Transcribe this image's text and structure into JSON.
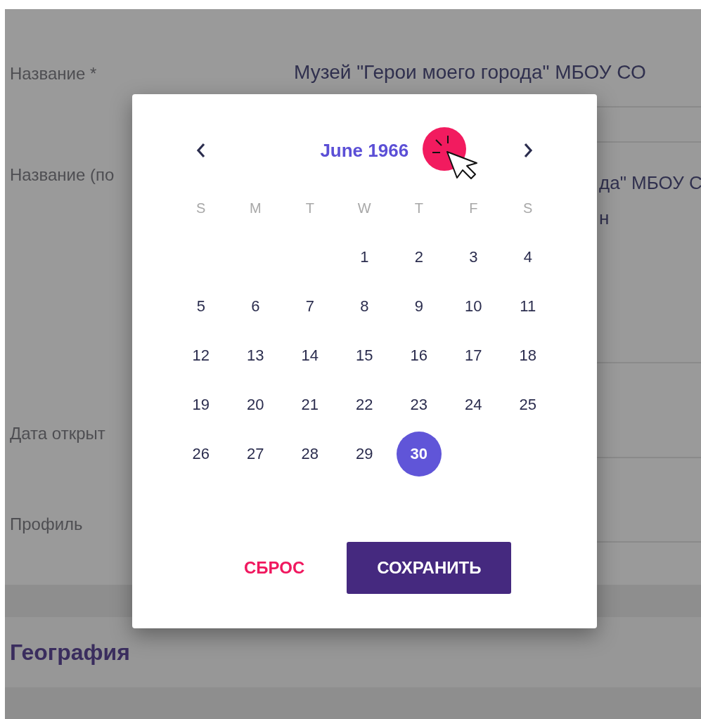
{
  "form": {
    "fields": [
      {
        "label": "Название *",
        "kind": "plain",
        "value_lines": [
          "Музей \"Герои моего города\" МБОУ СО"
        ]
      },
      {
        "label": "Название (по",
        "kind": "partly_covered",
        "value_lines": [
          "да\" МБОУ С",
          "н"
        ]
      },
      {
        "label": "Дата открыт",
        "kind": "plain"
      },
      {
        "label": "Профиль",
        "kind": "plain"
      }
    ]
  },
  "section": {
    "title": "География"
  },
  "date_picker": {
    "month_title": "June 1966",
    "weekdays": [
      "S",
      "M",
      "T",
      "W",
      "T",
      "F",
      "S"
    ],
    "weeks": [
      {
        "kind": "end_aligned",
        "days": [
          {
            "day": "1",
            "selected": false
          },
          {
            "day": "2",
            "selected": false
          },
          {
            "day": "3",
            "selected": false
          },
          {
            "day": "4",
            "selected": false
          }
        ]
      },
      {
        "kind": "start_aligned",
        "days": [
          {
            "day": "5",
            "selected": false
          },
          {
            "day": "6",
            "selected": false
          },
          {
            "day": "7",
            "selected": false
          },
          {
            "day": "8",
            "selected": false
          },
          {
            "day": "9",
            "selected": false
          },
          {
            "day": "10",
            "selected": false
          },
          {
            "day": "11",
            "selected": false
          }
        ]
      },
      {
        "kind": "start_aligned",
        "days": [
          {
            "day": "12",
            "selected": false
          },
          {
            "day": "13",
            "selected": false
          },
          {
            "day": "14",
            "selected": false
          },
          {
            "day": "15",
            "selected": false
          },
          {
            "day": "16",
            "selected": false
          },
          {
            "day": "17",
            "selected": false
          },
          {
            "day": "18",
            "selected": false
          }
        ]
      },
      {
        "kind": "start_aligned",
        "days": [
          {
            "day": "19",
            "selected": false
          },
          {
            "day": "20",
            "selected": false
          },
          {
            "day": "21",
            "selected": false
          },
          {
            "day": "22",
            "selected": false
          },
          {
            "day": "23",
            "selected": false
          },
          {
            "day": "24",
            "selected": false
          },
          {
            "day": "25",
            "selected": false
          }
        ]
      },
      {
        "kind": "start_aligned",
        "days": [
          {
            "day": "26",
            "selected": false
          },
          {
            "day": "27",
            "selected": false
          },
          {
            "day": "28",
            "selected": false
          },
          {
            "day": "29",
            "selected": false
          },
          {
            "day": "30",
            "selected": true
          }
        ]
      }
    ],
    "buttons": [
      {
        "label": "СБРОС",
        "kind": "text"
      },
      {
        "label": "СОХРАНИТЬ",
        "kind": "filled"
      }
    ]
  }
}
